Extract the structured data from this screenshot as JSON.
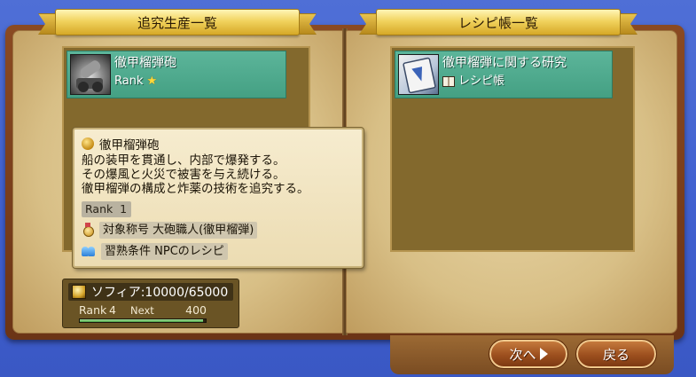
{
  "left_page": {
    "header": "追究生産一覧",
    "items": [
      {
        "title": "徹甲榴弾砲",
        "rank_label": "Rank",
        "rank_stars": "★",
        "icon": "cannon-icon"
      }
    ]
  },
  "right_page": {
    "header": "レシピ帳一覧",
    "items": [
      {
        "title": "徹甲榴弾に関する研究",
        "sub": "レシピ帳",
        "icon": "recipe-book-icon"
      }
    ]
  },
  "tooltip": {
    "title": "徹甲榴弾砲",
    "description": [
      "船の装甲を貫通し、内部で爆発する。",
      "その爆風と火災で被害を与え続ける。",
      "徹甲榴弾の構成と炸薬の技術を追究する。"
    ],
    "rank": "Rank  1",
    "title_requirement_label": "対象称号",
    "title_requirement_value": "大砲職人(徹甲榴弾)",
    "condition_label": "習熟条件",
    "condition_value": "NPCのレシピ"
  },
  "currency": {
    "label": "ソフィア:10000/65000",
    "rank_label": "Rank",
    "rank_value": "4",
    "next_label": "Next",
    "next_value": "400",
    "xp_fraction": 0.98
  },
  "buttons": {
    "next": "次へ",
    "back": "戻る"
  }
}
